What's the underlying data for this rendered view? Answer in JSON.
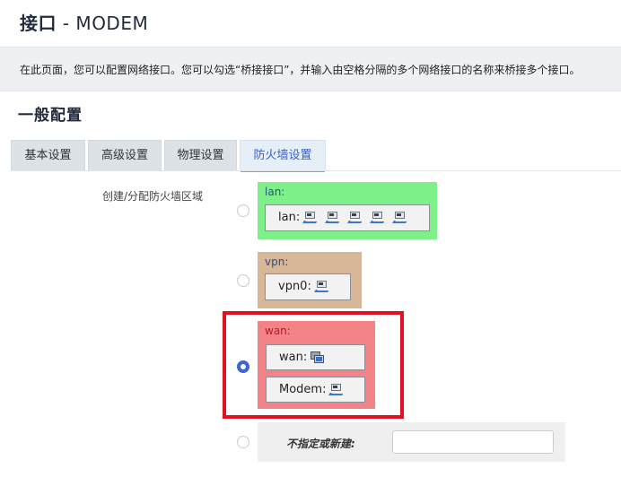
{
  "header": {
    "title_zh": "接口",
    "title_rest": " - MODEM"
  },
  "description": "在此页面，您可以配置网络接口。您可以勾选“桥接接口”，并输入由空格分隔的多个网络接口的名称来桥接多个接口。",
  "section_title": "一般配置",
  "tabs": [
    {
      "label": "基本设置",
      "active": false
    },
    {
      "label": "高级设置",
      "active": false
    },
    {
      "label": "物理设置",
      "active": false
    },
    {
      "label": "防火墙设置",
      "active": true
    }
  ],
  "firewall": {
    "field_label": "创建/分配防火墙区域",
    "zones": [
      {
        "name": "lan:",
        "color": "#7ef08a",
        "selected": false,
        "interfaces": [
          {
            "name": "lan:",
            "icons": [
              "network-port-icon",
              "network-port-icon",
              "network-port-icon",
              "network-port-icon",
              "network-port-icon"
            ]
          }
        ]
      },
      {
        "name": "vpn:",
        "color": "#d7b797",
        "selected": false,
        "interfaces": [
          {
            "name": "vpn0:",
            "icons": [
              "network-port-icon"
            ]
          }
        ]
      },
      {
        "name": "wan:",
        "color": "#f38387",
        "selected": true,
        "interfaces": [
          {
            "name": "wan:",
            "icons": [
              "modem-windows-icon"
            ]
          },
          {
            "name": "Modem:",
            "icons": [
              "network-port-icon"
            ]
          }
        ]
      }
    ],
    "new_zone": {
      "label": "不指定或新建:",
      "value": "",
      "selected": false
    }
  },
  "colors": {
    "accent": "#3b62c4",
    "highlight_border": "#e4101f",
    "radio_checked": "#3b66d8"
  }
}
